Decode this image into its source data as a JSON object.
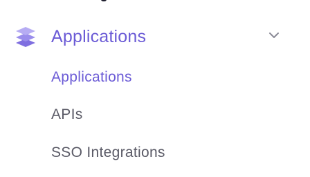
{
  "nav": {
    "section": {
      "title": "Applications",
      "icon": "layers-icon",
      "expanded": true,
      "accent_color": "#6b5bd6"
    },
    "items": [
      {
        "label": "Applications",
        "active": true
      },
      {
        "label": "APIs",
        "active": false
      },
      {
        "label": "SSO Integrations",
        "active": false
      }
    ],
    "text_color": "#5a5a66"
  }
}
